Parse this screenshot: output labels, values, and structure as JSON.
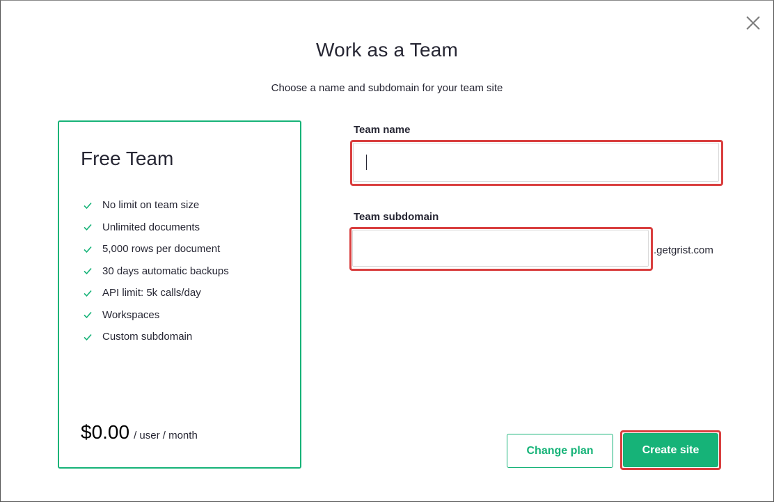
{
  "dialog": {
    "title": "Work as a Team",
    "subtitle": "Choose a name and subdomain for your team site"
  },
  "plan": {
    "name": "Free Team",
    "features": [
      "No limit on team size",
      "Unlimited documents",
      "5,000 rows per document",
      "30 days automatic backups",
      "API limit: 5k calls/day",
      "Workspaces",
      "Custom subdomain"
    ],
    "price": "$0.00",
    "price_unit": "/ user / month"
  },
  "form": {
    "team_name_label": "Team name",
    "team_name_value": "",
    "team_subdomain_label": "Team subdomain",
    "team_subdomain_value": "",
    "subdomain_suffix": ".getgrist.com"
  },
  "buttons": {
    "change_plan": "Change plan",
    "create_site": "Create site"
  },
  "colors": {
    "accent": "#16b378",
    "highlight": "#d93f3f"
  },
  "icons": {
    "close": "close-icon",
    "check": "check-icon"
  }
}
